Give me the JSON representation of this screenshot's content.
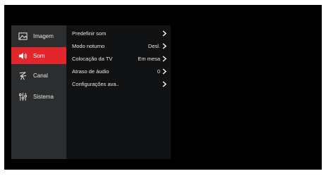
{
  "sidebar": {
    "items": [
      {
        "label": "Imagem",
        "icon": "image-icon",
        "active": false
      },
      {
        "label": "Som",
        "icon": "speaker-icon",
        "active": true
      },
      {
        "label": "Canal",
        "icon": "antenna-icon",
        "active": false
      },
      {
        "label": "Sistema",
        "icon": "sliders-icon",
        "active": false
      }
    ]
  },
  "panel": {
    "rows": [
      {
        "label": "Predefinir som",
        "value": ""
      },
      {
        "label": "Modo noturno",
        "value": "Desl."
      },
      {
        "label": "Colocação da TV",
        "value": "Em mesa"
      },
      {
        "label": "Atraso de áudio",
        "value": "0"
      },
      {
        "label": "Configurações ava..",
        "value": ""
      }
    ]
  },
  "colors": {
    "accent": "#e2262b",
    "sidebar_bg": "#2b2d2f",
    "panel_bg": "#111213",
    "screen_bg": "#000000"
  }
}
